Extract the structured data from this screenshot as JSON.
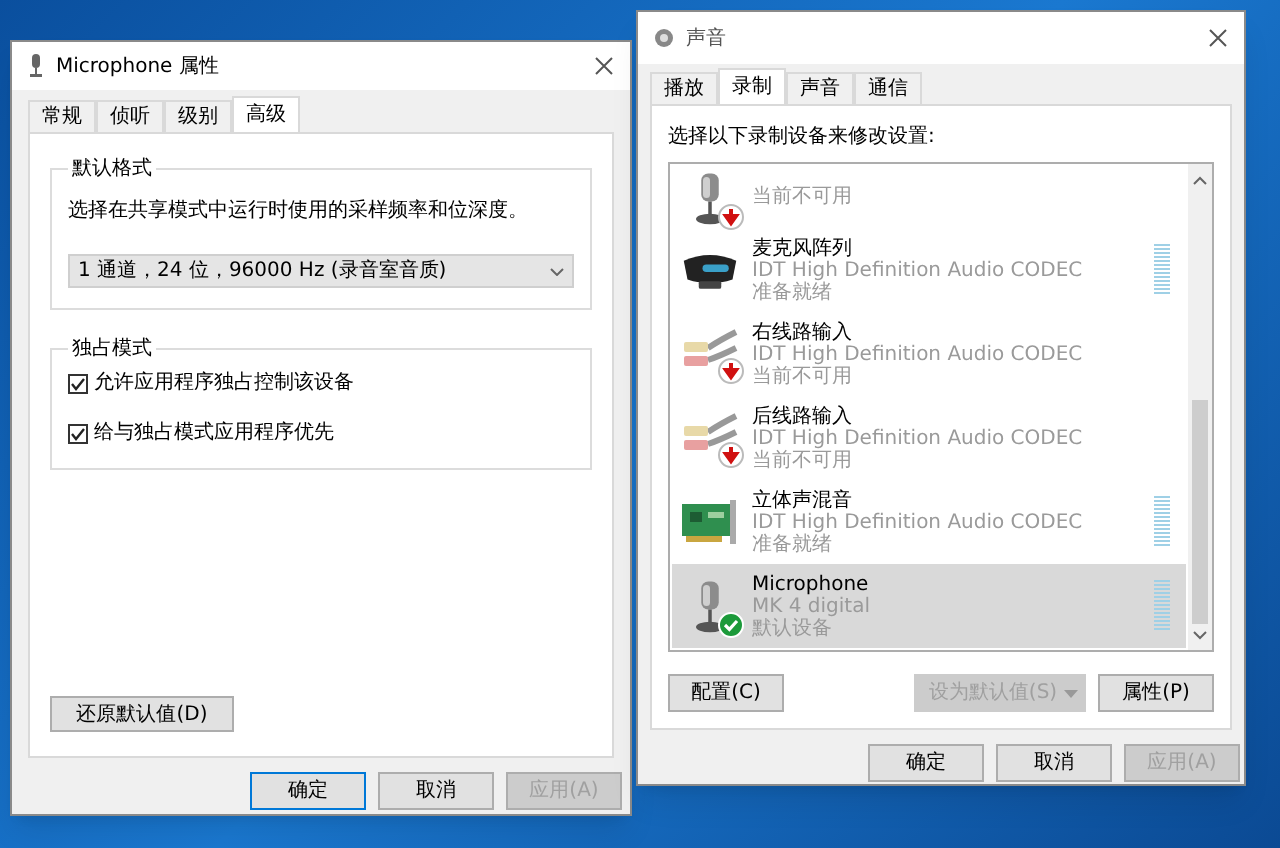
{
  "properties_window": {
    "title": "Microphone 属性",
    "tabs": [
      {
        "label": "常规",
        "selected": false
      },
      {
        "label": "侦听",
        "selected": false
      },
      {
        "label": "级别",
        "selected": false
      },
      {
        "label": "高级",
        "selected": true
      }
    ],
    "default_format": {
      "legend": "默认格式",
      "description": "选择在共享模式中运行时使用的采样频率和位深度。",
      "format_select": {
        "value": "1 通道，24 位，96000 Hz (录音室音质)"
      }
    },
    "exclusive_mode": {
      "legend": "独占模式",
      "options": [
        {
          "label": "允许应用程序独占控制该设备",
          "checked": true
        },
        {
          "label": "给与独占模式应用程序优先",
          "checked": true
        }
      ]
    },
    "restore_button": {
      "label": "还原默认值(D)"
    },
    "buttons": [
      {
        "label": "确定",
        "disabled": false,
        "default": true
      },
      {
        "label": "取消",
        "disabled": false,
        "default": false
      },
      {
        "label": "应用(A)",
        "disabled": true,
        "default": false
      }
    ]
  },
  "sound_window": {
    "title": "声音",
    "tabs": [
      {
        "label": "播放",
        "selected": false
      },
      {
        "label": "录制",
        "selected": true
      },
      {
        "label": "声音",
        "selected": false
      },
      {
        "label": "通信",
        "selected": false
      }
    ],
    "instruction": "选择以下录制设备来修改设置:",
    "devices": [
      {
        "kind": "microphone",
        "available": false,
        "default": false,
        "status": "当前不可用",
        "selected": false
      },
      {
        "kind": "webcam",
        "available": true,
        "default": false,
        "name": "麦克风阵列",
        "driver": "IDT High Definition Audio CODEC",
        "status": "准备就绪",
        "selected": false
      },
      {
        "kind": "cable",
        "available": false,
        "default": false,
        "name": "右线路输入",
        "driver": "IDT High Definition Audio CODEC",
        "status": "当前不可用",
        "selected": false
      },
      {
        "kind": "cable",
        "available": false,
        "default": false,
        "name": "后线路输入",
        "driver": "IDT High Definition Audio CODEC",
        "status": "当前不可用",
        "selected": false
      },
      {
        "kind": "card",
        "available": true,
        "default": false,
        "name": "立体声混音",
        "driver": "IDT High Definition Audio CODEC",
        "status": "准备就绪",
        "selected": false
      },
      {
        "kind": "microphone",
        "available": true,
        "default": true,
        "name": "Microphone",
        "driver": "MK 4 digital",
        "status": "默认设备",
        "selected": true
      }
    ],
    "configure_button": {
      "label": "配置(C)",
      "disabled": false
    },
    "set_default_button": {
      "label": "设为默认值(S)",
      "disabled": true
    },
    "properties_button": {
      "label": "属性(P)",
      "disabled": false
    },
    "buttons": [
      {
        "label": "确定",
        "disabled": false,
        "default": false
      },
      {
        "label": "取消",
        "disabled": false,
        "default": false
      },
      {
        "label": "应用(A)",
        "disabled": true,
        "default": false
      }
    ]
  }
}
